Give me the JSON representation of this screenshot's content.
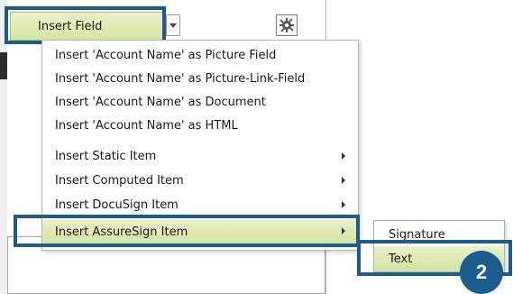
{
  "toolbar": {
    "insert_field_label": "Insert Field",
    "dropdown_icon": "chevron-down-icon",
    "settings_icon": "gear-icon"
  },
  "menu": {
    "items": [
      {
        "label": "Insert 'Account Name' as Picture Field",
        "submenu": false
      },
      {
        "label": "Insert 'Account Name' as Picture-Link-Field",
        "submenu": false
      },
      {
        "label": "Insert 'Account Name' as Document",
        "submenu": false
      },
      {
        "label": "Insert 'Account Name' as HTML",
        "submenu": false
      },
      {
        "label": "Insert Static Item",
        "submenu": true
      },
      {
        "label": "Insert Computed Item",
        "submenu": true
      },
      {
        "label": "Insert DocuSign Item",
        "submenu": true
      },
      {
        "label": "Insert AssureSign Item",
        "submenu": true,
        "active": true
      }
    ]
  },
  "submenu": {
    "items": [
      {
        "label": "Signature"
      },
      {
        "label": "Text",
        "active": true
      }
    ]
  },
  "step_badge": {
    "number": "2"
  },
  "colors": {
    "highlight_border": "#1d5b8f",
    "selected_gradient_top": "#e9f2c9",
    "selected_gradient_bottom": "#d3e39f",
    "badge_background": "#1c5d90"
  }
}
